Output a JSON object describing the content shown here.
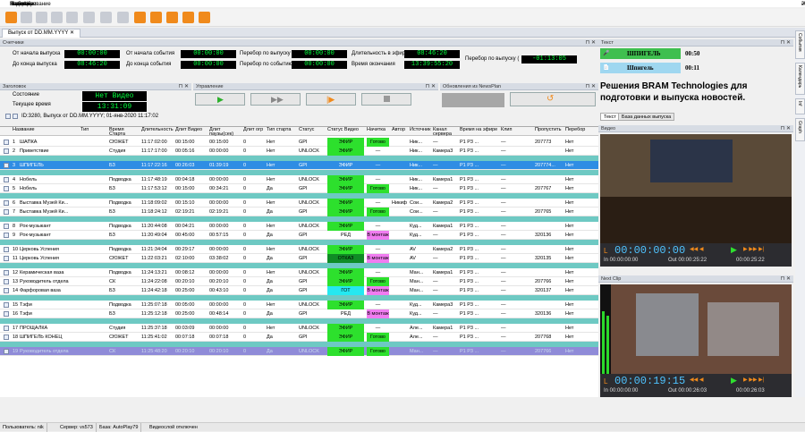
{
  "menu": [
    "NewsAir",
    "Редактирование",
    "Панели",
    "Шаблоны",
    "Настройки",
    "Помощь"
  ],
  "doc_tab": "Выпуск от DD.MM.YYYY",
  "counters": {
    "title": "Счетчики",
    "from_start_release_label": "От начала выпуска",
    "from_start_release": "00:00:00",
    "from_start_event_label": "От начала события",
    "from_start_event": "00:00:00",
    "overrun_release_label": "Перебор по выпуску",
    "overrun_release": "00:00:00",
    "duration_air_label": "Длительность в эфир",
    "duration_air": "08:46:20",
    "overrun_release2_label": "Перебор по выпуску (",
    "overrun_release2": "-01:13:05",
    "to_end_release_label": "До конца выпуска",
    "to_end_release": "08:46:20",
    "to_end_event_label": "До конца события",
    "to_end_event": "00:00:00",
    "overrun_event_label": "Перебор по событию",
    "overrun_event": "00:00:00",
    "end_time_label": "Время окончания",
    "end_time": "13:39:55:20"
  },
  "header": {
    "title": "Заголовок",
    "state_label": "Состояние",
    "state_value": "Нет Видео",
    "time_label": "Текущее время",
    "time_value": "13:31:09",
    "info": "ID:3280, Выпуск от DD.MM.YYYY;  01-янв-2020   11:17:02"
  },
  "control": {
    "title": "Управление"
  },
  "updates": {
    "title": "Обновления из NewsPlan"
  },
  "text_panel": {
    "title": "Текст",
    "item1": "ШПИГЕЛЬ",
    "item1_time": "00:50",
    "item2": "Шпигель",
    "item2_time": "00:11",
    "headline": "Решения BRAM Technologies для подготовки и выпуска новостей.",
    "tab1": "Текст",
    "tab2": "База данных выпуска"
  },
  "video_panel": {
    "title": "Видео",
    "timecode": "00:00:00:00",
    "in": "In 00:00:00:00",
    "out": "Out 00:00:25:22",
    "right": "00:00:25:22"
  },
  "next_panel": {
    "title": "Next Clip",
    "timecode": "00:00:19:15",
    "in": "In 00:00:00:00",
    "out": "Out 00:00:26:03",
    "right": "00:00:26:03"
  },
  "side_tabs": [
    "События",
    "Календарь",
    "Inf",
    "Graph"
  ],
  "columns": [
    "",
    "Название",
    "Тип",
    "Время Старта",
    "Длительность",
    "Длит Видео",
    "Длит паузы(сек)",
    "Длит огр",
    "Тип старта",
    "Статус",
    "Статус Видео",
    "Начитка",
    "Автор",
    "Источник",
    "Канал сервера",
    "Время на эфире",
    "Клип",
    "Пропустить",
    "Перебор"
  ],
  "rows": [
    {
      "n": "1",
      "name": "ШАПКА",
      "type": "СЮЖЕТ",
      "start": "11:17:02:00",
      "dur": "00:15:00",
      "vdur": "00:15:00",
      "pause": "0",
      "ogr": "Нет",
      "stype": "GPI",
      "status": "ЭФИР",
      "scls": "st-green",
      "vstat": "Готово",
      "vcls": "st-green",
      "nach": "",
      "author": "Ник...",
      "src": "—",
      "chan": "P1 P3 ...",
      "air": "—",
      "clip": "207773",
      "skip": "Нет",
      "sep": false
    },
    {
      "n": "2",
      "name": "Приветствие",
      "type": "Студия",
      "start": "11:17:17:00",
      "dur": "00:05:16",
      "vdur": "00:00:00",
      "pause": "0",
      "ogr": "Нет",
      "stype": "UNLOCK",
      "status": "ЭФИР",
      "scls": "st-green",
      "vstat": "—",
      "vcls": "",
      "nach": "",
      "author": "Ник...",
      "src": "Камера3",
      "chan": "P1 P3 ...",
      "air": "—",
      "clip": "",
      "skip": "Нет",
      "sep": true
    },
    {
      "n": "3",
      "name": "ШПИГЕЛЬ",
      "type": "БЗ",
      "start": "11:17:22:16",
      "dur": "00:26:03",
      "vdur": "01:39:19",
      "pause": "0",
      "ogr": "Нет",
      "stype": "GPI",
      "status": "ЭФИР",
      "scls": "",
      "vstat": "—",
      "vcls": "",
      "nach": "",
      "author": "Ник...",
      "src": "—",
      "chan": "P1 P3 ...",
      "air": "—",
      "clip": "207774...",
      "skip": "Нет",
      "sel": true,
      "sep": true
    },
    {
      "n": "4",
      "name": "Нобель",
      "type": "Подводка",
      "start": "11:17:48:19",
      "dur": "00:04:18",
      "vdur": "00:00:00",
      "pause": "0",
      "ogr": "Нет",
      "stype": "UNLOCK",
      "status": "ЭФИР",
      "scls": "st-green",
      "vstat": "—",
      "vcls": "",
      "nach": "",
      "author": "Ник...",
      "src": "Камера1",
      "chan": "P1 P3 ...",
      "air": "—",
      "clip": "",
      "skip": "Нет",
      "sep": false
    },
    {
      "n": "5",
      "name": "Нобель",
      "type": "БЗ",
      "start": "11:17:53:12",
      "dur": "00:15:00",
      "vdur": "00:34:21",
      "pause": "0",
      "ogr": "Да",
      "stype": "GPI",
      "status": "ЭФИР",
      "scls": "st-green",
      "vstat": "Готово",
      "vcls": "st-green",
      "nach": "",
      "author": "Ник...",
      "src": "—",
      "chan": "P1 P3 ...",
      "air": "—",
      "clip": "207767",
      "skip": "Нет",
      "sep": true
    },
    {
      "n": "6",
      "name": "Выставка Музей Ки...",
      "type": "Подводка",
      "start": "11:18:09:02",
      "dur": "00:15:10",
      "vdur": "00:00:00",
      "pause": "0",
      "ogr": "Нет",
      "stype": "UNLOCK",
      "status": "ЭФИР",
      "scls": "st-green",
      "vstat": "—",
      "vcls": "",
      "nach": "Никиф...",
      "author": "Сои...",
      "src": "Камера2",
      "chan": "P1 P3 ...",
      "air": "—",
      "clip": "",
      "skip": "Нет",
      "sep": false
    },
    {
      "n": "7",
      "name": "Выставка Музей Ки...",
      "type": "БЗ",
      "start": "11:18:24:12",
      "dur": "02:19:21",
      "vdur": "02:19:21",
      "pause": "0",
      "ogr": "Да",
      "stype": "GPI",
      "status": "ЭФИР",
      "scls": "st-green",
      "vstat": "Готово",
      "vcls": "st-green",
      "nach": "",
      "author": "Сои...",
      "src": "—",
      "chan": "P1 P3 ...",
      "air": "—",
      "clip": "207765",
      "skip": "Нет",
      "sep": true
    },
    {
      "n": "8",
      "name": "Рок-музыкант",
      "type": "Подводка",
      "start": "11:20:44:08",
      "dur": "00:04:21",
      "vdur": "00:00:00",
      "pause": "0",
      "ogr": "Нет",
      "stype": "UNLOCK",
      "status": "ЭФИР",
      "scls": "st-green",
      "vstat": "—",
      "vcls": "",
      "nach": "",
      "author": "Куд...",
      "src": "Камера1",
      "chan": "P1 P3 ...",
      "air": "—",
      "clip": "",
      "skip": "Нет",
      "sep": false
    },
    {
      "n": "9",
      "name": "Рок-музыкант",
      "type": "БЗ",
      "start": "11:20:49:04",
      "dur": "00:45:00",
      "vdur": "00:57:15",
      "pause": "0",
      "ogr": "Да",
      "stype": "GPI",
      "status": "РЕД",
      "scls": "",
      "vstat": "В монтаж",
      "vcls": "st-pink",
      "nach": "",
      "author": "Куд...",
      "src": "—",
      "chan": "P1 P3 ...",
      "air": "—",
      "clip": "320136",
      "skip": "Нет",
      "sep": true
    },
    {
      "n": "10",
      "name": "Церковь Успения",
      "type": "Подводка",
      "start": "11:21:34:04",
      "dur": "00:29:17",
      "vdur": "00:00:00",
      "pause": "0",
      "ogr": "Нет",
      "stype": "UNLOCK",
      "status": "ЭФИР",
      "scls": "st-green",
      "vstat": "—",
      "vcls": "",
      "nach": "",
      "author": "AV",
      "src": "Камера2",
      "chan": "P1 P3 ...",
      "air": "—",
      "clip": "",
      "skip": "Нет",
      "sep": false
    },
    {
      "n": "11",
      "name": "Церковь Успения",
      "type": "СЮЖЕТ",
      "start": "11:22:03:21",
      "dur": "02:10:00",
      "vdur": "03:38:02",
      "pause": "0",
      "ogr": "Да",
      "stype": "GPI",
      "status": "ОТКАЗ",
      "scls": "st-dkg",
      "vstat": "В монтаж",
      "vcls": "st-pink",
      "nach": "",
      "author": "AV",
      "src": "—",
      "chan": "P1 P3 ...",
      "air": "—",
      "clip": "320135",
      "skip": "Нет",
      "sep": true
    },
    {
      "n": "12",
      "name": "Керамическая ваза",
      "type": "Подводка",
      "start": "11:24:13:21",
      "dur": "00:08:12",
      "vdur": "00:00:00",
      "pause": "0",
      "ogr": "Нет",
      "stype": "UNLOCK",
      "status": "ЭФИР",
      "scls": "st-green",
      "vstat": "—",
      "vcls": "",
      "nach": "",
      "author": "Ман...",
      "src": "Камера1",
      "chan": "P1 P3 ...",
      "air": "—",
      "clip": "",
      "skip": "Нет",
      "sep": false
    },
    {
      "n": "13",
      "name": "Руководитель отдела",
      "type": "СК",
      "start": "11:24:22:08",
      "dur": "00:20:10",
      "vdur": "00:20:10",
      "pause": "0",
      "ogr": "Да",
      "stype": "GPI",
      "status": "ЭФИР",
      "scls": "st-green",
      "vstat": "Готово",
      "vcls": "st-green",
      "nach": "",
      "author": "Ман...",
      "src": "—",
      "chan": "P1 P3 ...",
      "air": "—",
      "clip": "207766",
      "skip": "Нет",
      "sep": false
    },
    {
      "n": "14",
      "name": "Фарфоровая ваза",
      "type": "БЗ",
      "start": "11:24:42:18",
      "dur": "00:25:00",
      "vdur": "00:43:10",
      "pause": "0",
      "ogr": "Да",
      "stype": "GPI",
      "status": "ГОТ",
      "scls": "st-cyan",
      "vstat": "В монтаж",
      "vcls": "st-pink",
      "nach": "",
      "author": "Ман...",
      "src": "—",
      "chan": "P1 P3 ...",
      "air": "—",
      "clip": "320137",
      "skip": "Нет",
      "sep": true
    },
    {
      "n": "15",
      "name": "Тэфи",
      "type": "Подводка",
      "start": "11:25:07:18",
      "dur": "00:05:00",
      "vdur": "00:00:00",
      "pause": "0",
      "ogr": "Нет",
      "stype": "UNLOCK",
      "status": "ЭФИР",
      "scls": "st-green",
      "vstat": "—",
      "vcls": "",
      "nach": "",
      "author": "Куд...",
      "src": "Камера3",
      "chan": "P1 P3 ...",
      "air": "—",
      "clip": "",
      "skip": "Нет",
      "sep": false
    },
    {
      "n": "16",
      "name": "Тэфи",
      "type": "БЗ",
      "start": "11:25:12:18",
      "dur": "00:25:00",
      "vdur": "00:48:14",
      "pause": "0",
      "ogr": "Да",
      "stype": "GPI",
      "status": "РЕД",
      "scls": "",
      "vstat": "В монтаж",
      "vcls": "st-pink",
      "nach": "",
      "author": "Куд...",
      "src": "—",
      "chan": "P1 P3 ...",
      "air": "—",
      "clip": "320136",
      "skip": "Нет",
      "sep": true
    },
    {
      "n": "17",
      "name": "ПРОЩАЛКА",
      "type": "Студия",
      "start": "11:25:37:18",
      "dur": "00:03:09",
      "vdur": "00:00:00",
      "pause": "0",
      "ogr": "Нет",
      "stype": "UNLOCK",
      "status": "ЭФИР",
      "scls": "st-green",
      "vstat": "—",
      "vcls": "",
      "nach": "",
      "author": "Але...",
      "src": "Камера1",
      "chan": "P1 P3 ...",
      "air": "—",
      "clip": "",
      "skip": "Нет",
      "sep": false
    },
    {
      "n": "18",
      "name": "ШПИГЕЛЬ КОНЕЦ",
      "type": "СЮЖЕТ",
      "start": "11:25:41:02",
      "dur": "00:07:18",
      "vdur": "00:07:18",
      "pause": "0",
      "ogr": "Да",
      "stype": "GPI",
      "status": "ЭФИР",
      "scls": "st-green",
      "vstat": "Готово",
      "vcls": "st-green",
      "nach": "",
      "author": "Але...",
      "src": "—",
      "chan": "P1 P3 ...",
      "air": "—",
      "clip": "207768",
      "skip": "Нет",
      "sep": true
    },
    {
      "n": "19",
      "name": "Руководитель отдела",
      "type": "СК",
      "start": "11:25:48:20",
      "dur": "00:20:10",
      "vdur": "00:20:10",
      "pause": "0",
      "ogr": "Да",
      "stype": "UNLOCK",
      "status": "ЭФИР",
      "scls": "st-green",
      "vstat": "Готово",
      "vcls": "st-green",
      "nach": "",
      "author": "Ман...",
      "src": "—",
      "chan": "P1 P3 ...",
      "air": "—",
      "clip": "207766",
      "skip": "Нет",
      "last": true,
      "sep": false
    }
  ],
  "status": {
    "user": "Пользователь: nik",
    "server": "Сервер: vs573",
    "db": "База: AutoPlay79",
    "video": "Видеослой отключен"
  }
}
